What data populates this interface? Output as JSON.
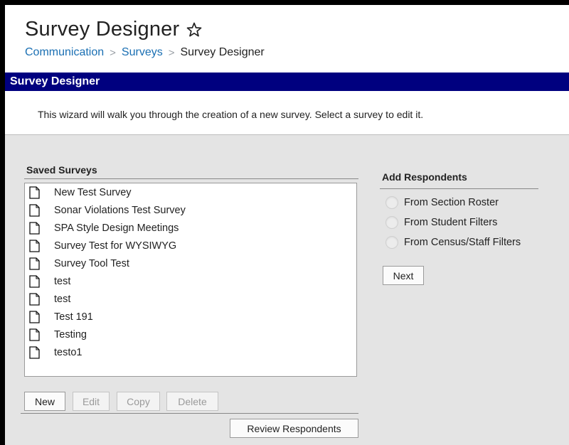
{
  "page": {
    "title": "Survey Designer",
    "breadcrumb": [
      "Communication",
      "Surveys",
      "Survey Designer"
    ],
    "breadcrumb_separator": ">"
  },
  "banner": {
    "title": "Survey Designer"
  },
  "intro": {
    "text": "This wizard will walk you through the creation of a new survey. Select a survey to edit it."
  },
  "saved_surveys": {
    "title": "Saved Surveys",
    "items": [
      "New Test Survey",
      "Sonar Violations Test Survey",
      "SPA Style Design Meetings",
      "Survey Test for WYSIWYG",
      "Survey Tool Test",
      "test",
      "test",
      "Test 191",
      "Testing",
      "testo1"
    ],
    "buttons": {
      "new": "New",
      "edit": "Edit",
      "copy": "Copy",
      "delete": "Delete"
    },
    "review_button": "Review Respondents"
  },
  "add_respondents": {
    "title": "Add Respondents",
    "options": [
      "From Section Roster",
      "From Student Filters",
      "From Census/Staff Filters"
    ],
    "next_button": "Next"
  },
  "colors": {
    "banner": "#00007f",
    "link": "#1a6fb3",
    "panel_background": "#e4e4e4"
  }
}
